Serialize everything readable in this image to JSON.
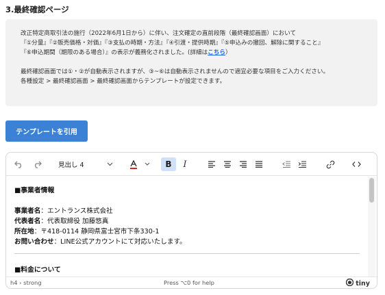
{
  "section": {
    "title": "3.最終確認ページ"
  },
  "notice": {
    "line1": "改正特定商取引法の施行（2022年6月1日から）に伴い、注文確定の直前段階（最終確認画面）において",
    "line2": "『①分量』『②販売価格・対価』『③支払の時期・方法』『④引渡・提供時期』『⑤申込みの撤回、解除に関すること』",
    "line3_before": "『⑥申込期間（期限のある場合）』の表示が義務化されました。(詳細は",
    "line3_link": "こちら",
    "line3_after": "）",
    "line4": "最終確認画面では①・②が自動表示されますが、③~⑥は自動表示されませんので適宜必要な項目をご入力ください。",
    "line5": "各種設定 > 最終確認画面 > 最終確認画面からテンプレートが設定できます。"
  },
  "apply_button": {
    "label": "テンプレートを引用"
  },
  "toolbar": {
    "block_format": "見出し 4",
    "bold": "B",
    "italic": "I"
  },
  "content": {
    "heading1": "■事業者情報",
    "rows": [
      {
        "label": "事業者名",
        "value": "：エントランス株式会社"
      },
      {
        "label": "代表者名",
        "value": "：代表取締役 加藤悠真"
      },
      {
        "label": "所在地",
        "value": "：〒418-0114 静岡県富士宮市下条330-1"
      },
      {
        "label": "お問い合わせ",
        "value": "：LINE公式アカウントにて対応いたします。"
      }
    ],
    "heading2": "■料金について"
  },
  "statusbar": {
    "path": "h4 › strong",
    "help": "Press ⌥0 for help",
    "brand": "tiny"
  },
  "colors": {
    "accent": "#3b82d6",
    "link": "#1a66d6",
    "notice_bg": "#f2f2f2",
    "bold_active": "#cfe0f7"
  }
}
